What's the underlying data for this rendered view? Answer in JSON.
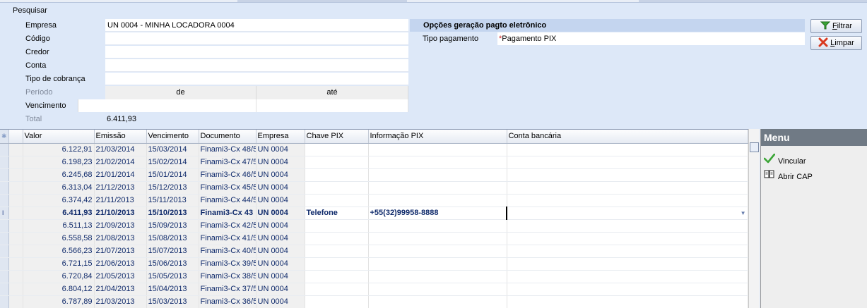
{
  "search": {
    "title": "Pesquisar",
    "fields": [
      {
        "label": "Empresa",
        "value": "UN 0004 - MINHA LOCADORA 0004"
      },
      {
        "label": "Código",
        "value": ""
      },
      {
        "label": "Credor",
        "value": ""
      },
      {
        "label": "Conta",
        "value": ""
      },
      {
        "label": "Tipo de cobrança",
        "value": ""
      }
    ],
    "periodo_label": "Período",
    "de_label": "de",
    "ate_label": "até",
    "vencimento_label": "Vencimento",
    "total_label": "Total",
    "total_value": "6.411,93"
  },
  "options": {
    "title": "Opções geração pagto eletrônico",
    "tipo_label": "Tipo pagamento",
    "tipo_required": "*",
    "tipo_value": "Pagamento PIX"
  },
  "buttons": {
    "filtrar": {
      "accel": "F",
      "rest": "iltrar"
    },
    "limpar": {
      "accel": "L",
      "rest": "impar"
    }
  },
  "grid": {
    "columns": [
      "Valor",
      "Emissão",
      "Vencimento",
      "Documento",
      "Empresa",
      "Chave PIX",
      "Informação PIX",
      "Conta bancária"
    ],
    "rows": [
      [
        "6.122,91",
        "21/03/2014",
        "15/03/2014",
        "Finami3-Cx 48/5",
        "UN 0004",
        "",
        "",
        ""
      ],
      [
        "6.198,23",
        "21/02/2014",
        "15/02/2014",
        "Finami3-Cx 47/5",
        "UN 0004",
        "",
        "",
        ""
      ],
      [
        "6.245,68",
        "21/01/2014",
        "15/01/2014",
        "Finami3-Cx 46/5",
        "UN 0004",
        "",
        "",
        ""
      ],
      [
        "6.313,04",
        "21/12/2013",
        "15/12/2013",
        "Finami3-Cx 45/5",
        "UN 0004",
        "",
        "",
        ""
      ],
      [
        "6.374,42",
        "21/11/2013",
        "15/11/2013",
        "Finami3-Cx 44/5",
        "UN 0004",
        "",
        "",
        ""
      ],
      [
        "6.411,93",
        "21/10/2013",
        "15/10/2013",
        "Finami3-Cx 43",
        "UN 0004",
        "Telefone",
        "+55(32)99958-8888",
        ""
      ],
      [
        "6.511,13",
        "21/09/2013",
        "15/09/2013",
        "Finami3-Cx 42/5",
        "UN 0004",
        "",
        "",
        ""
      ],
      [
        "6.558,58",
        "21/08/2013",
        "15/08/2013",
        "Finami3-Cx 41/5",
        "UN 0004",
        "",
        "",
        ""
      ],
      [
        "6.566,23",
        "21/07/2013",
        "15/07/2013",
        "Finami3-Cx 40/5",
        "UN 0004",
        "",
        "",
        ""
      ],
      [
        "6.721,15",
        "21/06/2013",
        "15/06/2013",
        "Finami3-Cx 39/5",
        "UN 0004",
        "",
        "",
        ""
      ],
      [
        "6.720,84",
        "21/05/2013",
        "15/05/2013",
        "Finami3-Cx 38/5",
        "UN 0004",
        "",
        "",
        ""
      ],
      [
        "6.804,12",
        "21/04/2013",
        "15/04/2013",
        "Finami3-Cx 37/5",
        "UN 0004",
        "",
        "",
        ""
      ],
      [
        "6.787,89",
        "21/03/2013",
        "15/03/2013",
        "Finami3-Cx 36/5",
        "UN 0004",
        "",
        "",
        ""
      ]
    ],
    "selected_row": 5
  },
  "menu": {
    "title": "Menu",
    "items": [
      {
        "label": "Vincular",
        "icon": "check-icon"
      },
      {
        "label": "Abrir CAP",
        "icon": "book-icon"
      }
    ]
  },
  "colors": {
    "accent": "#c4d5ef",
    "background": "#dde8f8",
    "menu_header": "#707a85",
    "grid_text": "#0f2a6b"
  }
}
